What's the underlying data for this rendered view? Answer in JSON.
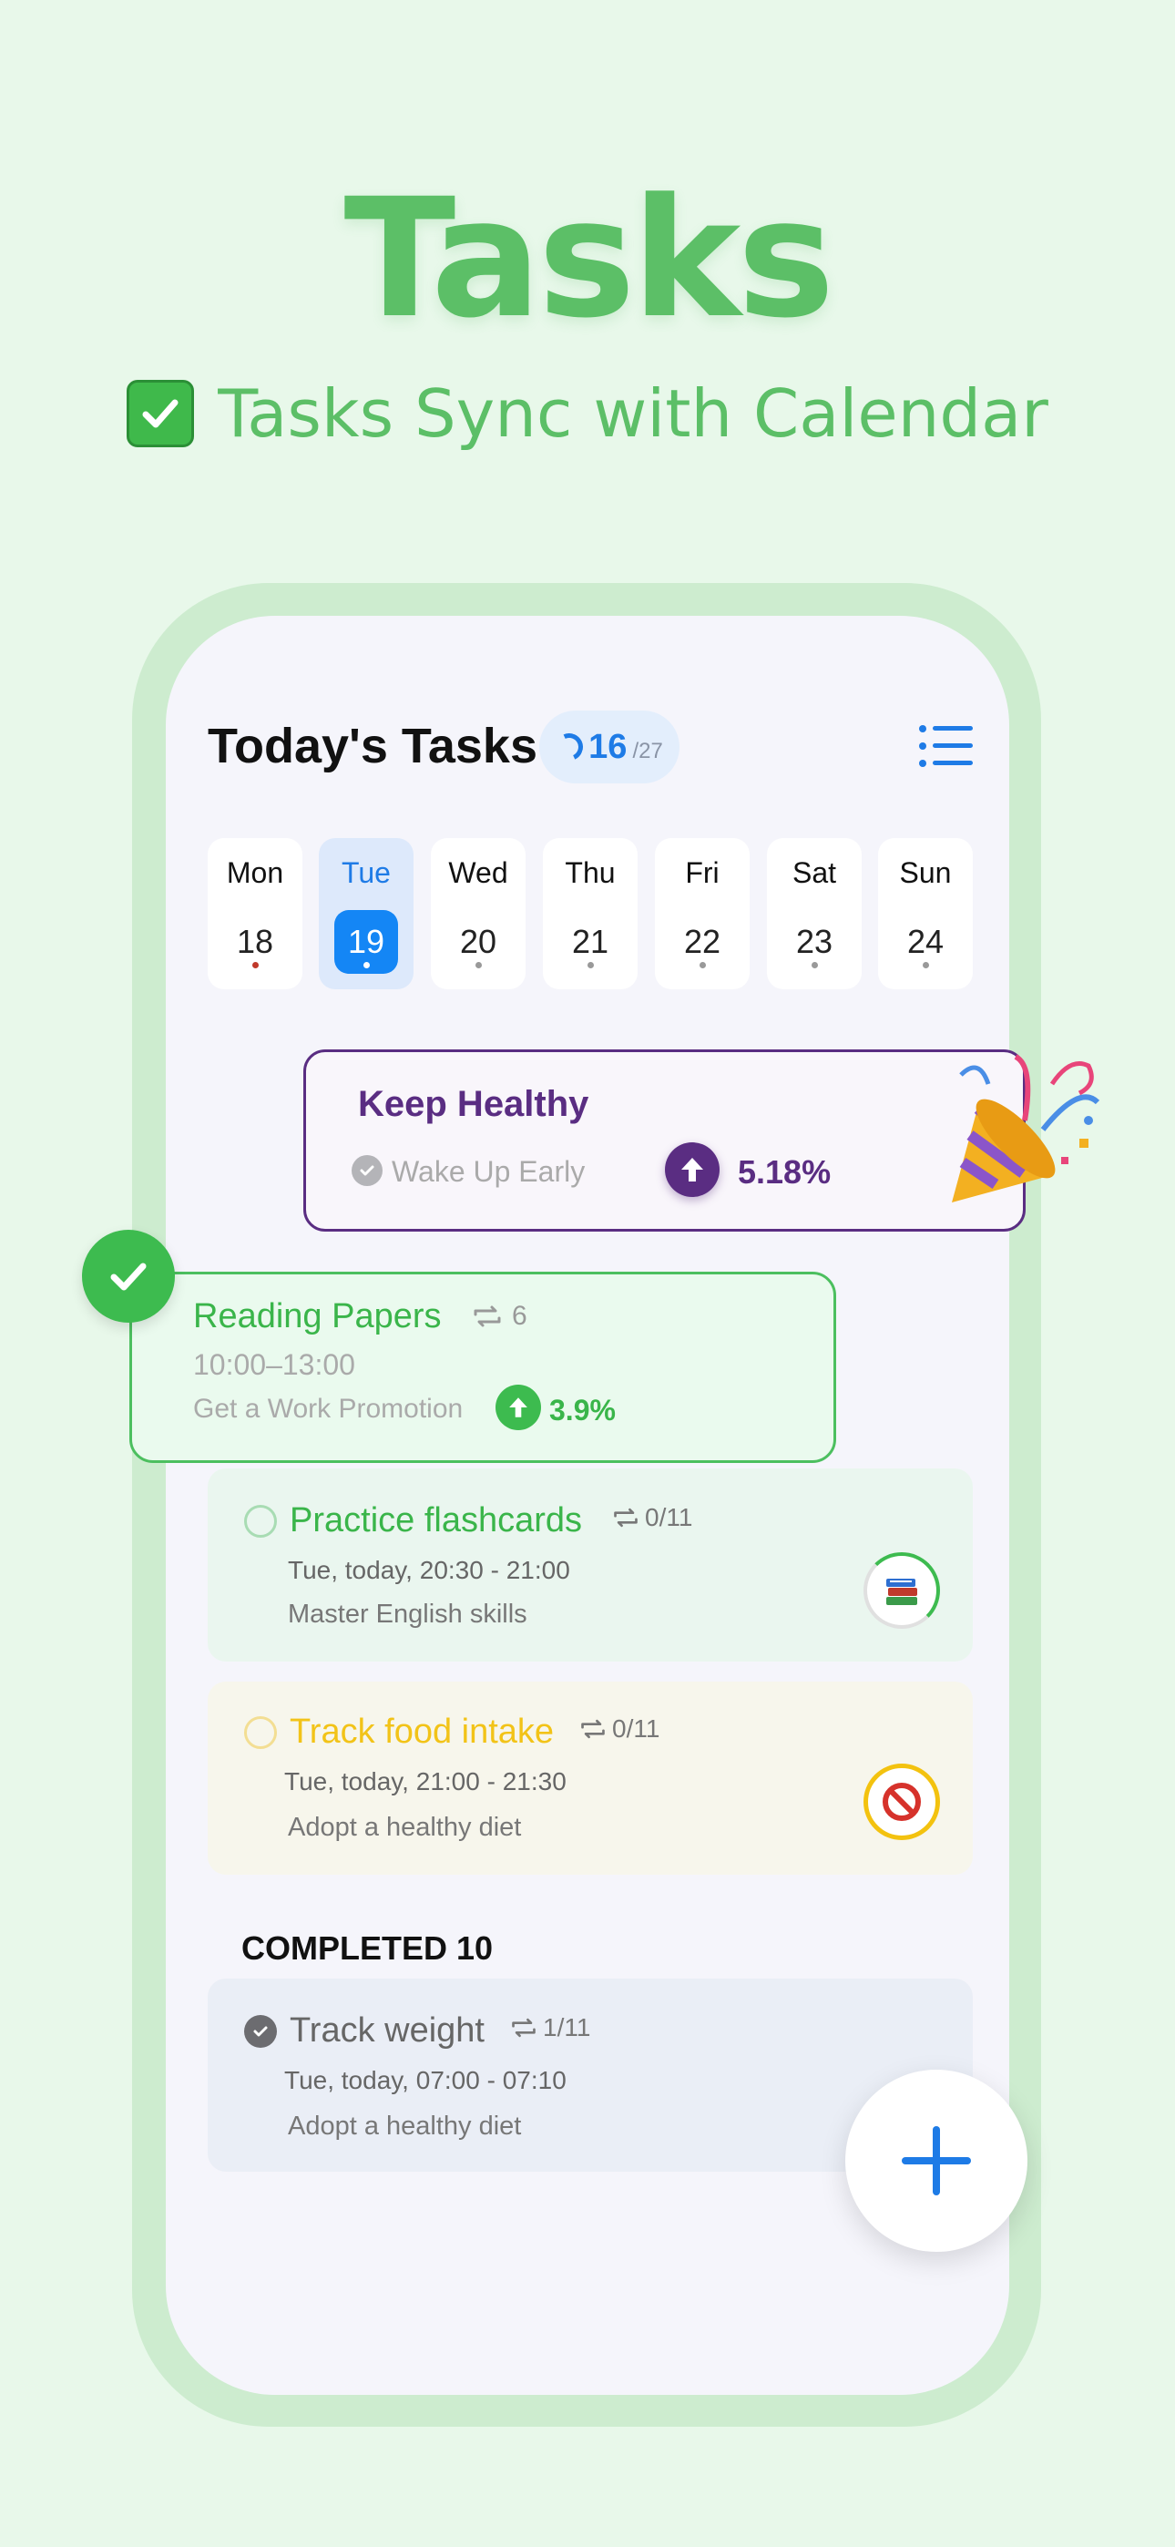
{
  "hero": {
    "title": "Tasks",
    "subtitle": "Tasks Sync with Calendar"
  },
  "header": {
    "title": "Today's Tasks",
    "done_count": "16",
    "total_count": "/27"
  },
  "week": [
    {
      "name": "Mon",
      "date": "18",
      "selected": false
    },
    {
      "name": "Tue",
      "date": "19",
      "selected": true
    },
    {
      "name": "Wed",
      "date": "20",
      "selected": false
    },
    {
      "name": "Thu",
      "date": "21",
      "selected": false
    },
    {
      "name": "Fri",
      "date": "22",
      "selected": false
    },
    {
      "name": "Sat",
      "date": "23",
      "selected": false
    },
    {
      "name": "Sun",
      "date": "24",
      "selected": false
    }
  ],
  "goal_card": {
    "title": "Keep Healthy",
    "subtask": "Wake Up Early",
    "percent": "5.18%"
  },
  "reading_card": {
    "title": "Reading Papers",
    "repeat": "6",
    "time": "10:00–13:00",
    "goal": "Get a Work Promotion",
    "percent": "3.9%"
  },
  "tasks": [
    {
      "title": "Practice flashcards",
      "repeat": "0/11",
      "time": "Tue, today, 20:30 - 21:00",
      "goal": "Master English skills",
      "icon": "books-icon"
    },
    {
      "title": "Track food intake",
      "repeat": "0/11",
      "time": "Tue, today, 21:00 - 21:30",
      "goal": "Adopt a healthy diet",
      "icon": "prohibited-icon"
    }
  ],
  "completed": {
    "label": "COMPLETED 10",
    "tasks": [
      {
        "title": "Track weight",
        "repeat": "1/11",
        "time": "Tue, today, 07:00 - 07:10",
        "goal": "Adopt a healthy diet"
      }
    ]
  },
  "colors": {
    "brand_green": "#5cbf67",
    "accent_blue": "#1e7be6",
    "goal_purple": "#5a2d82",
    "food_yellow": "#f2c318"
  }
}
